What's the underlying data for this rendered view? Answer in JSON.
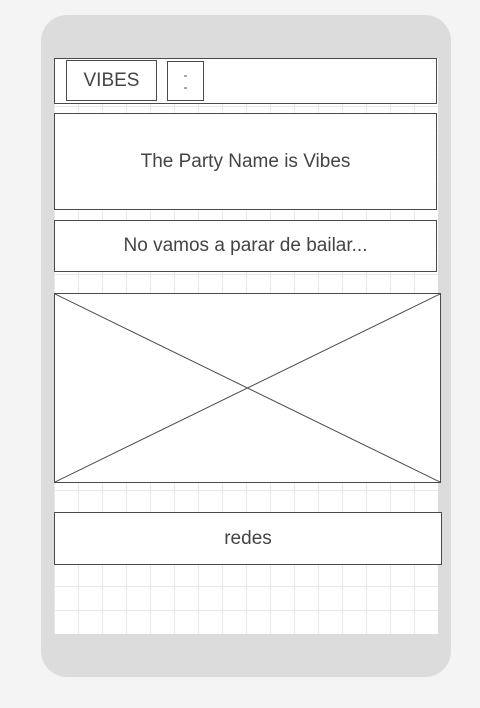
{
  "header": {
    "logo_text": "VIBES",
    "menu_lines": [
      "-",
      "-"
    ]
  },
  "hero": {
    "title": "The Party Name is Vibes",
    "subtitle": "No vamos a parar de bailar..."
  },
  "footer": {
    "social_label": "redes"
  },
  "colors": {
    "device_frame": "#dcdcdc",
    "border": "#4a4a4a",
    "text": "#444444"
  }
}
